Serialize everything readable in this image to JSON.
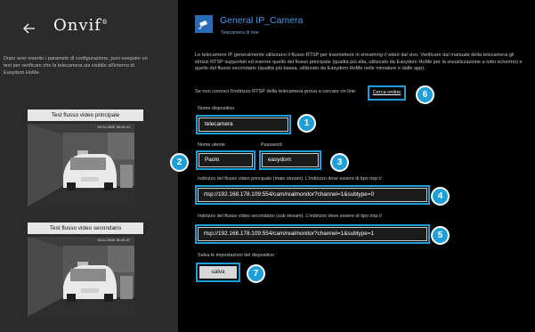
{
  "header": {
    "logo_text": "Onvif",
    "logo_mark": "®",
    "back_icon": "arrow-left-icon"
  },
  "left": {
    "description": "Dopo aver inserito i parametri di configurazione, puoi eseguire un test per verificare che la telecamera sia visibile all'interno di Easydom HoMe.",
    "test_main_label": "Test flusso video principale",
    "test_sub_label": "Test flusso video secondario",
    "video_main_timestamp": "02/11/2020 09:28:21",
    "video_sub_timestamp": "02/11/2020 09:28:27"
  },
  "camera": {
    "title": "General IP_Camera",
    "subtitle": "Telecamera di rete",
    "icon": "camera-icon"
  },
  "intro": "Le telecamere IP generalmente utilizzano il flusso RTSP per trasmettere in streaming il video dal vivo. Verificare dal manuale della telecamera gli idirizzi RTSP supportati ed inserire quello del flusso principale (qualità più alta, utilizzato da Easydom HoMe per la visualizzazione a tutto schermo) e quello del flusso secondario (qualità più bassa, utilizzato da Easydom HoMe nelle miniature e dalle app).",
  "hint": "Se non conosci l'indirizzo RTSP della telecamera prova a cercare on line:",
  "search_link": "Cerca online",
  "form": {
    "device_label": "Nome dispositivo",
    "device_value": "telecamera",
    "user_label": "Nome utente",
    "user_value": "Paolo",
    "pass_label": "Password",
    "pass_value": "easydom",
    "main_label": "Indirizzo del flusso video principale (main stream). L'indirizzo deve essere di tipo rtsp://",
    "main_value": "rtsp://192.168.178.109:554/cam/realmonitor?channel=1&subtype=0",
    "sub_label": "Indirizzo del flusso video secondario (sub stream). L'indirizzo deve essere di tipo rtsp://",
    "sub_value": "rtsp://192.168.178.109:554/cam/realmonitor?channel=1&subtype=1",
    "save_label": "Salva le impostazioni del dispositivo",
    "save_button": "salva"
  },
  "badges": [
    "1",
    "2",
    "3",
    "4",
    "5",
    "6",
    "7"
  ],
  "colors": {
    "accent": "#1e9fd8",
    "title_blue": "#4a9ae8",
    "left_bg": "#2b2b2b",
    "right_bg": "#000000"
  }
}
